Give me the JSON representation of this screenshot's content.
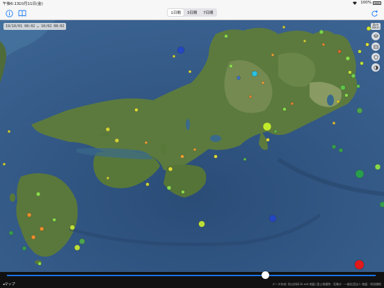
{
  "statusbar": {
    "time": "午後6:13",
    "date": "10月11日(金)",
    "battery_pct": "100%"
  },
  "navbar": {
    "info_icon": "info-icon",
    "map_icon": "book-icon",
    "refresh_icon": "refresh-icon",
    "segments": [
      {
        "label": "1日間",
        "active": true
      },
      {
        "label": "3日間",
        "active": false
      },
      {
        "label": "7日間",
        "active": false
      }
    ]
  },
  "map": {
    "time_range": "19/10/01 08:02 … 10/02 08:02",
    "side_tools": {
      "depth_label": "0km\n40km",
      "icons": [
        "layers-icon",
        "film-icon",
        "shield-icon",
        "contrast-icon"
      ]
    }
  },
  "timeline": {
    "position": 0.7
  },
  "footer": {
    "map_label": "◂マップ",
    "attribution": "データ作成: 防災科研 Hi-net 地図: 国土地理院 · 気象庁 · 一般社団法人  地図 · 利用規約"
  },
  "colors": {
    "accent": "#1677f2",
    "track": "#1b74e8",
    "sea": "#2e4f78"
  }
}
